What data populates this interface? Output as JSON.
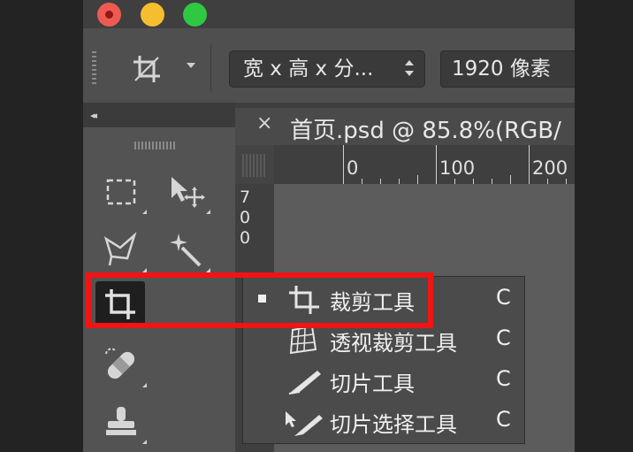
{
  "window": {
    "controls": [
      "close",
      "minimize",
      "zoom"
    ]
  },
  "options_bar": {
    "tool_icon": "crop-icon",
    "ratio_preset": "宽 x 高 x 分...",
    "width_value": "1920 像素"
  },
  "document": {
    "tab_title": "首页.psd @ 85.8%(RGB/",
    "close_symbol": "×"
  },
  "ruler": {
    "top_labels": [
      "0",
      "100",
      "200"
    ],
    "left_digits": [
      "7",
      "0",
      "0"
    ]
  },
  "tools": {
    "collapse_symbol": "◂◂",
    "items": [
      {
        "name": "rectangular-marquee-icon"
      },
      {
        "name": "move-icon"
      },
      {
        "name": "polygonal-lasso-icon"
      },
      {
        "name": "magic-wand-icon"
      },
      {
        "name": "crop-icon"
      },
      {
        "name": "spot-healing-icon"
      },
      {
        "name": "clone-stamp-icon"
      }
    ]
  },
  "flyout": {
    "items": [
      {
        "label": "裁剪工具",
        "shortcut": "C",
        "selected": true,
        "icon": "crop-icon"
      },
      {
        "label": "透视裁剪工具",
        "shortcut": "C",
        "selected": false,
        "icon": "perspective-crop-icon"
      },
      {
        "label": "切片工具",
        "shortcut": "C",
        "selected": false,
        "icon": "slice-icon"
      },
      {
        "label": "切片选择工具",
        "shortcut": "C",
        "selected": false,
        "icon": "slice-select-icon"
      }
    ]
  },
  "colors": {
    "highlight": "#f01414",
    "panel": "#535353",
    "dark": "#232323"
  }
}
